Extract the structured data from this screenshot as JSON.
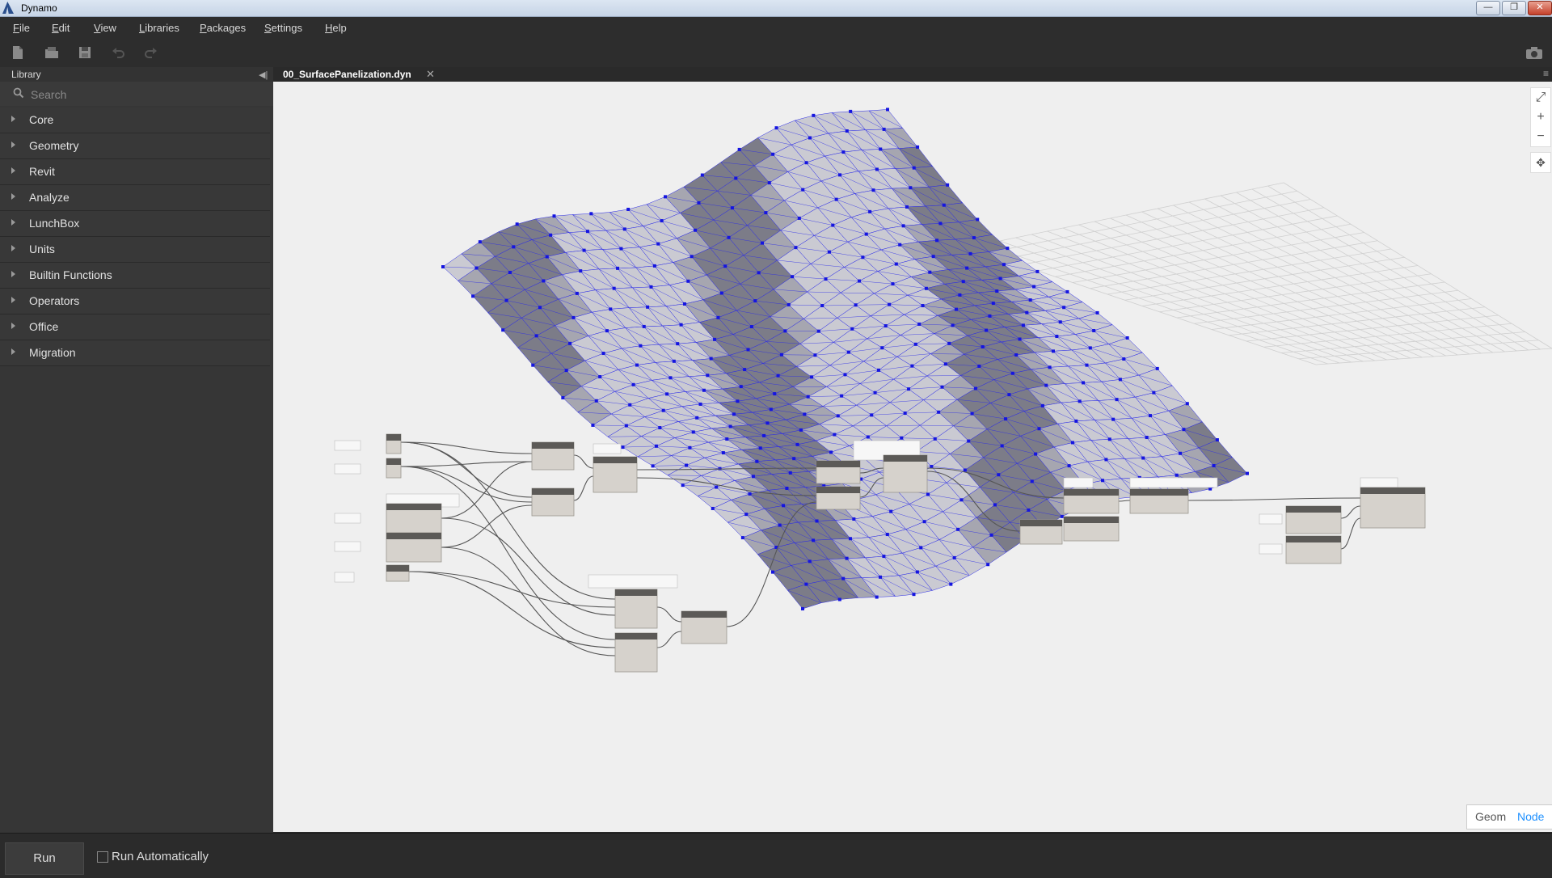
{
  "window": {
    "title": "Dynamo",
    "min": "—",
    "restore": "❐",
    "close": "✕"
  },
  "menu": [
    "File",
    "Edit",
    "View",
    "Libraries",
    "Packages",
    "Settings",
    "Help"
  ],
  "library": {
    "title": "Library",
    "collapse": "◀|",
    "search_placeholder": "Search",
    "categories": [
      "Core",
      "Geometry",
      "Revit",
      "Analyze",
      "LunchBox",
      "Units",
      "Builtin Functions",
      "Operators",
      "Office",
      "Migration"
    ]
  },
  "tab": {
    "label": "00_SurfacePanelization.dyn",
    "close": "✕"
  },
  "zoom": {
    "fit": "⤢",
    "in": "+",
    "out": "−",
    "pan": "✥"
  },
  "view_toggle": {
    "geom": "Geom",
    "node": "Node"
  },
  "run": {
    "button": "Run",
    "auto_label": "Run Automatically"
  },
  "colors": {
    "accent": "#1e90ff",
    "mesh": "#1515e0",
    "canvas": "#efefef",
    "panel": "#363636"
  },
  "icons": [
    "new-file-icon",
    "open-file-icon",
    "save-icon",
    "undo-icon",
    "redo-icon",
    "camera-icon",
    "search-icon"
  ]
}
